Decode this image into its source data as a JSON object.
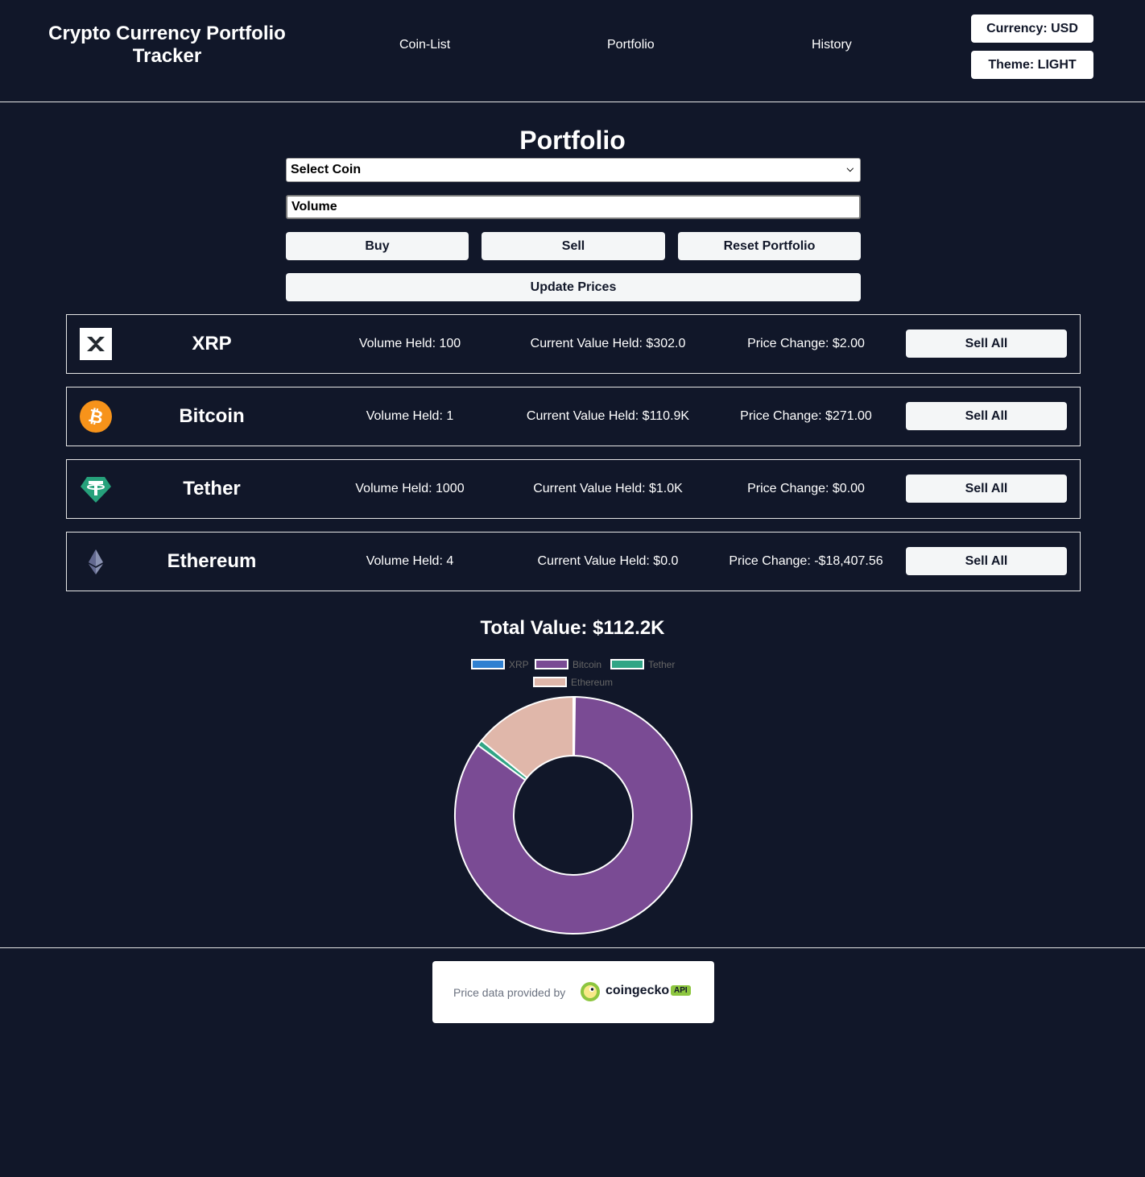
{
  "header": {
    "title": "Crypto Currency Portfolio Tracker",
    "nav": {
      "coin_list": "Coin-List",
      "portfolio": "Portfolio",
      "history": "History"
    },
    "currency_button": "Currency: USD",
    "theme_button": "Theme: LIGHT"
  },
  "main": {
    "title": "Portfolio",
    "select": {
      "selected": "Select Coin"
    },
    "volume": {
      "placeholder": "Volume"
    },
    "buttons": {
      "buy": "Buy",
      "sell": "Sell",
      "reset": "Reset Portfolio",
      "update": "Update Prices"
    }
  },
  "holdings": [
    {
      "name": "XRP",
      "volume": "Volume Held: 100",
      "value": "Current Value Held: $302.0",
      "change": "Price Change: $2.00",
      "sell_all": "Sell All",
      "icon": "xrp-icon"
    },
    {
      "name": "Bitcoin",
      "volume": "Volume Held: 1",
      "value": "Current Value Held: $110.9K",
      "change": "Price Change: $271.00",
      "sell_all": "Sell All",
      "icon": "bitcoin-icon"
    },
    {
      "name": "Tether",
      "volume": "Volume Held: 1000",
      "value": "Current Value Held: $1.0K",
      "change": "Price Change: $0.00",
      "sell_all": "Sell All",
      "icon": "tether-icon"
    },
    {
      "name": "Ethereum",
      "volume": "Volume Held: 4",
      "value": "Current Value Held: $0.0",
      "change": "Price Change: -$18,407.56",
      "sell_all": "Sell All",
      "icon": "ethereum-icon"
    }
  ],
  "summary": {
    "total": "Total Value: $112.2K"
  },
  "chart_data": {
    "type": "pie",
    "variant": "doughnut",
    "categories": [
      "XRP",
      "Bitcoin",
      "Tether",
      "Ethereum"
    ],
    "values": [
      302.0,
      110900,
      1000,
      18500
    ],
    "colors": [
      "#2f80d1",
      "#7a4b94",
      "#30a585",
      "#e0b7aa"
    ],
    "legend_position": "top",
    "title": ""
  },
  "footer": {
    "attribution_text": "Price data provided by",
    "brand": "coingecko",
    "api_badge": "API"
  },
  "colors": {
    "background": "#111729",
    "card_border": "#e6e6e6",
    "button_bg": "#f4f6f7"
  }
}
